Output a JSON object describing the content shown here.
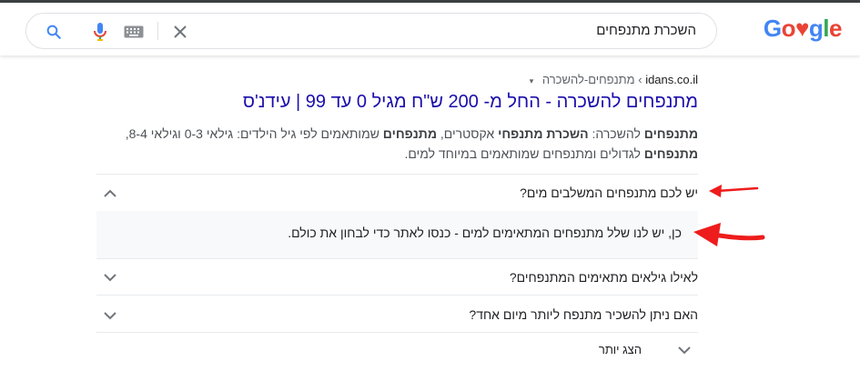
{
  "search": {
    "query": "השכרת מתנפחים",
    "logo_letters": [
      "G",
      "o",
      "♥",
      "g",
      "l",
      "e"
    ],
    "logo_colors": [
      "#4285f4",
      "#ea4335",
      "#ea4335",
      "#4285f4",
      "#34a853",
      "#ea4335"
    ]
  },
  "result": {
    "domain": "idans.co.il",
    "separator": "›",
    "path": "מתנפחים-להשכרה",
    "menu_arrow": "▾",
    "title": "מתנפחים להשכרה - החל מ- 200 ש\"ח מגיל 0 עד 99 | עידנ'ס",
    "snippet_line1": [
      {
        "text": "מתנפחים",
        "bold": true
      },
      {
        "text": " להשכרה: ",
        "bold": false
      },
      {
        "text": "השכרת מתנפחי",
        "bold": true
      },
      {
        "text": " אקסטרים, ",
        "bold": false
      },
      {
        "text": "מתנפחים",
        "bold": true
      },
      {
        "text": " שמותאמים לפי גיל הילדים: גילאי 0-3 וגילאי 8-4,",
        "bold": false
      }
    ],
    "snippet_line2": [
      {
        "text": "מתנפחים",
        "bold": true
      },
      {
        "text": " לגדולים ומתנפחים שמותאמים במיוחד למים.",
        "bold": false
      }
    ]
  },
  "faq": [
    {
      "question": "יש לכם מתנפחים המשלבים מים?",
      "expanded": true,
      "answer": "כן, יש לנו שלל מתנפחים המתאימים למים - כנסו לאתר כדי לבחון את כולם."
    },
    {
      "question": "לאילו גילאים מתאימים המתנפחים?",
      "expanded": false
    },
    {
      "question": "האם ניתן להשכיר מתנפח ליותר מיום אחד?",
      "expanded": false
    }
  ],
  "show_more": "הצג יותר",
  "colors": {
    "title": "#1a0dab",
    "annotation": "#ff0000",
    "mic_blue": "#4285f4"
  }
}
